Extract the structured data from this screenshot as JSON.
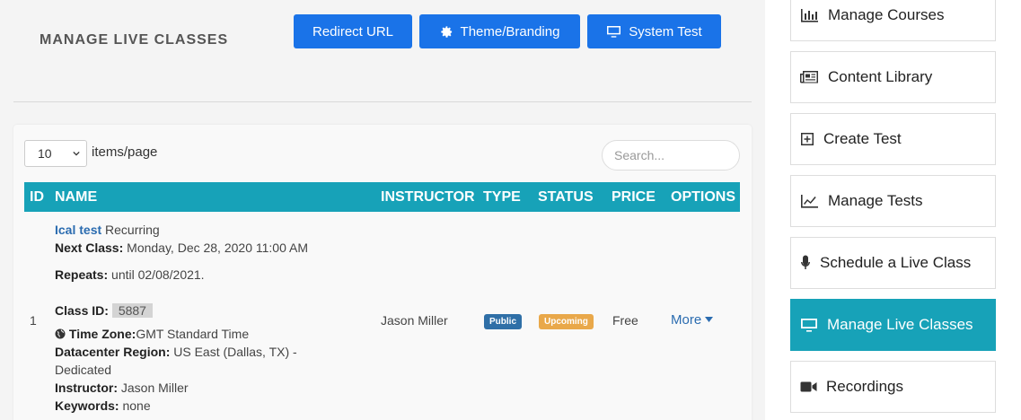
{
  "header": {
    "title": "MANAGE LIVE CLASSES",
    "buttons": {
      "redirect": "Redirect URL",
      "theme": "Theme/Branding",
      "system_test": "System Test"
    }
  },
  "table_controls": {
    "per_page_value": "10",
    "per_page_label": "items/page",
    "search_placeholder": "Search..."
  },
  "columns": {
    "id": "ID",
    "name": "NAME",
    "instructor": "INSTRUCTOR",
    "type": "TYPE",
    "status": "STATUS",
    "price": "PRICE",
    "options": "OPTIONS"
  },
  "row": {
    "id": "1",
    "class_name": "Ical test",
    "recurrence": "Recurring",
    "next_class_label": "Next Class:",
    "next_class_value": "Monday, Dec 28, 2020 11:00 AM",
    "repeats_label": "Repeats:",
    "repeats_value": "until 02/08/2021.",
    "class_id_label": "Class ID:",
    "class_id_value": "5887",
    "timezone_label": "Time Zone:",
    "timezone_value": "GMT Standard Time",
    "datacenter_label": "Datacenter Region:",
    "datacenter_value": "US East (Dallas, TX) -",
    "datacenter_value_2": "Dedicated",
    "instructor_label": "Instructor:",
    "instructor_value": "Jason Miller",
    "keywords_label": "Keywords:",
    "keywords_value": "none",
    "instructor": "Jason Miller",
    "type": "Public",
    "status": "Upcoming",
    "price": "Free",
    "options": "More"
  },
  "sidebar": {
    "items": [
      {
        "label": "Manage Courses",
        "icon": "bar-chart-icon"
      },
      {
        "label": "Content Library",
        "icon": "newspaper-icon"
      },
      {
        "label": "Create Test",
        "icon": "plus-square-icon"
      },
      {
        "label": "Manage Tests",
        "icon": "line-chart-icon"
      },
      {
        "label": "Schedule a Live Class",
        "icon": "microphone-icon"
      },
      {
        "label": "Manage Live Classes",
        "icon": "monitor-icon"
      },
      {
        "label": "Recordings",
        "icon": "video-camera-icon"
      }
    ],
    "active_index": 5
  },
  "colors": {
    "primary": "#1a73e8",
    "teal": "#17a2b8",
    "public_badge": "#2f6fa7",
    "upcoming_badge": "#e9a84a"
  }
}
